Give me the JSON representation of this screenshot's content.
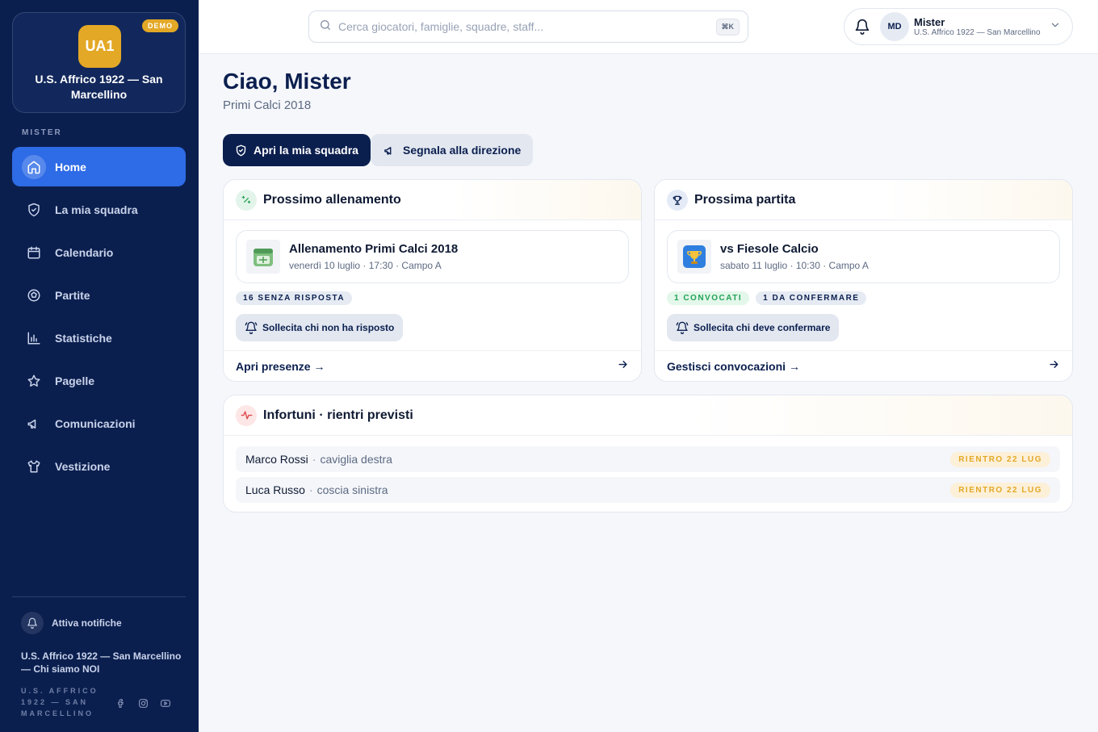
{
  "sidebar": {
    "club_logo": "UA1",
    "demo_badge": "DEMO",
    "club_name": "U.S. Affrico 1922 — San Marcellino",
    "section_label": "MISTER",
    "items": [
      {
        "label": "Home",
        "icon": "home-icon",
        "active": true
      },
      {
        "label": "La mia squadra",
        "icon": "shield-icon",
        "active": false
      },
      {
        "label": "Calendario",
        "icon": "calendar-icon",
        "active": false
      },
      {
        "label": "Partite",
        "icon": "soccer-ball-icon",
        "active": false
      },
      {
        "label": "Statistiche",
        "icon": "bar-chart-icon",
        "active": false
      },
      {
        "label": "Pagelle",
        "icon": "star-icon",
        "active": false
      },
      {
        "label": "Comunicazioni",
        "icon": "megaphone-icon",
        "active": false
      },
      {
        "label": "Vestizione",
        "icon": "shirt-icon",
        "active": false
      }
    ],
    "notifications_label": "Attiva notifiche",
    "footer_club": "U.S. Affrico 1922 — San Marcellino — Chi siamo NOI",
    "footer_small": "U.S. AFFRICO 1922 — SAN MARCELLINO",
    "socials": [
      "facebook-icon",
      "instagram-icon",
      "youtube-icon"
    ]
  },
  "topbar": {
    "search_placeholder": "Cerca giocatori, famiglie, squadre, staff...",
    "search_shortcut": "⌘K",
    "user_initials": "MD",
    "user_name": "Mister",
    "user_club": "U.S. Affrico 1922 — San Marcellino"
  },
  "main": {
    "greeting": "Ciao, Mister",
    "team": "Primi Calci 2018",
    "btn_open_team": "Apri la mia squadra",
    "btn_report": "Segnala alla direzione"
  },
  "training_card": {
    "title": "Prossimo allenamento",
    "event_title": "Allenamento Primi Calci 2018",
    "event_sub": "venerdì 10 luglio · 17:30 · Campo A",
    "badges": [
      "16 SENZA RISPOSTA"
    ],
    "remind_label": "Sollecita chi non ha risposto",
    "footer_link": "Apri presenze →"
  },
  "match_card": {
    "title": "Prossima partita",
    "event_title": "vs Fiesole Calcio",
    "event_sub": "sabato 11 luglio · 10:30 · Campo A",
    "badges": [
      "1 CONVOCATI",
      "1 DA CONFERMARE"
    ],
    "remind_label": "Sollecita chi deve confermare",
    "footer_link": "Gestisci convocazioni →"
  },
  "injuries_card": {
    "title": "Infortuni · rientri previsti",
    "rows": [
      {
        "name": "Marco Rossi",
        "part": "caviglia destra",
        "return": "RIENTRO 22 LUG"
      },
      {
        "name": "Luca Russo",
        "part": "coscia sinistra",
        "return": "RIENTRO 22 LUG"
      }
    ]
  },
  "colors": {
    "sidebar_bg": "#0b1f4f",
    "accent_blue": "#2e6be6",
    "gold": "#e3a826",
    "green": "#22a356"
  }
}
